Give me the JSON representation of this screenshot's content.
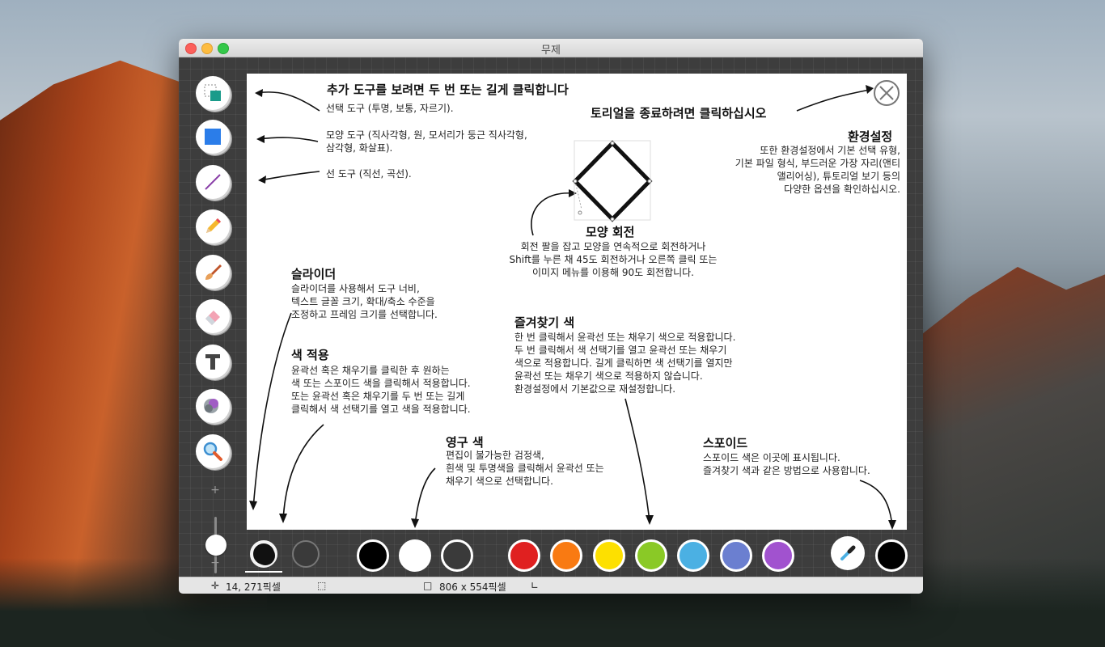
{
  "window": {
    "title": "무제"
  },
  "tutorial": {
    "more_tools": "추가 도구를 보려면 두 번 또는 길게 클릭합니다",
    "select_tool": "선택 도구 (투명, 보통, 자르기).",
    "shape_tool": "모양 도구 (직사각형, 원, 모서리가 둥근 직사각형,\n삼각형, 화살표).",
    "line_tool": "선 도구 (직선, 곡선).",
    "exit": "토리얼을 종료하려면 클릭하십시오",
    "prefs_title": "환경설정",
    "prefs_body": "또한 환경설정에서 기본 선택 유형,\n기본 파일 형식, 부드러운 가장 자리(앤티\n앨리어싱), 튜토리얼 보기 등의\n다양한 옵션을 확인하십시오.",
    "rotate_title": "모양 회전",
    "rotate_body": "회전 팔을 잡고 모양을 연속적으로 회전하거나\nShift를 누른 채 45도 회전하거나 오른쪽 클릭 또는\n이미지 메뉴를 이용해 90도 회전합니다.",
    "slider_title": "슬라이더",
    "slider_body": "슬라이더를 사용해서 도구 너비,\n텍스트 글꼴 크기, 확대/축소 수준을\n조정하고 프레임 크기를 선택합니다.",
    "apply_title": "색 적용",
    "apply_body": "윤곽선 혹은 채우기를 클릭한 후 원하는\n색 또는 스포이드 색을 클릭해서 적용합니다.\n또는 윤곽선 혹은 채우기를 두 번 또는 길게\n클릭해서 색 선택기를 열고 색을 적용합니다.",
    "fav_title": "즐겨찾기 색",
    "fav_body": "한 번 클릭해서 윤곽선 또는 채우기 색으로 적용합니다.\n두 번 클릭해서 색 선택기를 열고 윤곽선 또는 채우기\n색으로 적용합니다. 길게 클릭하면 색 선택기를 열지만\n윤곽선 또는 채우기 색으로 적용하지 않습니다.\n환경설정에서 기본값으로 재설정합니다.",
    "perm_title": "영구 색",
    "perm_body": "편집이 불가능한 검정색,\n흰색 및 투명색을 클릭해서 윤곽선 또는\n채우기 색으로 선택합니다.",
    "dropper_title": "스포이드",
    "dropper_body": "스포이드 색은 이곳에 표시됩니다.\n즐겨찾기 색과 같은 방법으로 사용합니다."
  },
  "zoom": {
    "plus": "+",
    "minus": "−"
  },
  "palette": {
    "permanent": [
      "#000000",
      "#ffffff",
      "transparent"
    ],
    "favorites": [
      "#e02020",
      "#f97a12",
      "#fde000",
      "#8ac926",
      "#4bb0e3",
      "#6b7fd0",
      "#a152cf"
    ],
    "dropper_color": "#000000"
  },
  "status": {
    "cursor": "14, 271픽셀",
    "size": "806 x 554픽셀"
  }
}
